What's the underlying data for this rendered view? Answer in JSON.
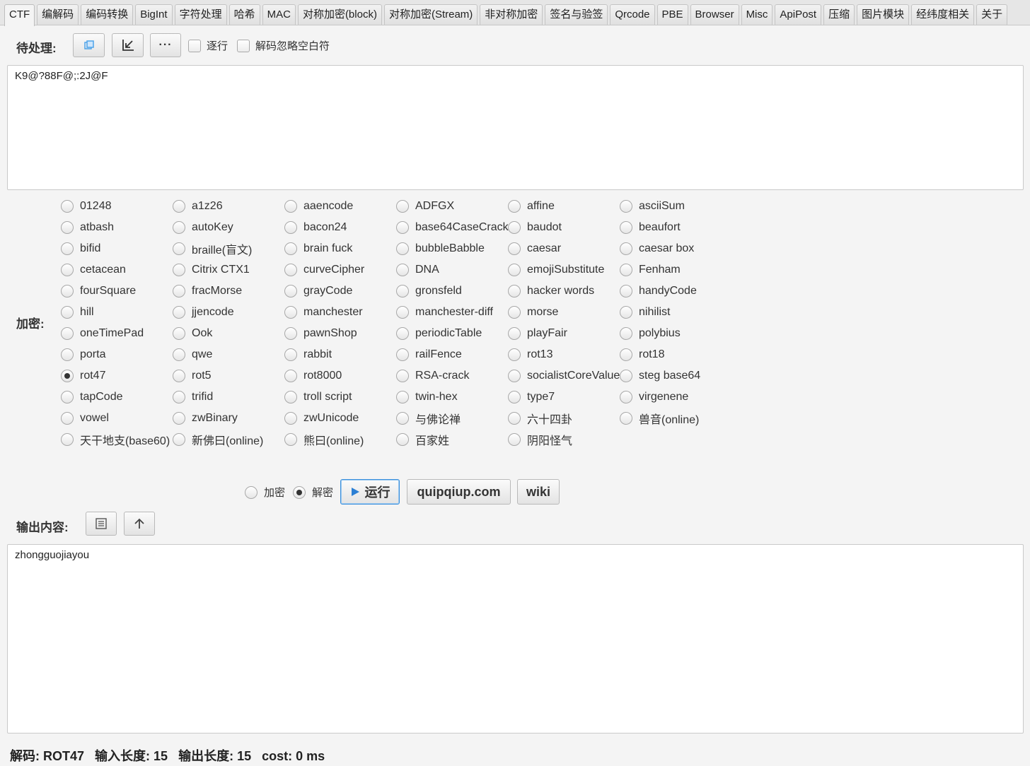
{
  "tabs": [
    "CTF",
    "编解码",
    "编码转换",
    "BigInt",
    "字符处理",
    "哈希",
    "MAC",
    "对称加密(block)",
    "对称加密(Stream)",
    "非对称加密",
    "签名与验签",
    "Qrcode",
    "PBE",
    "Browser",
    "Misc",
    "ApiPost",
    "压缩",
    "图片模块",
    "经纬度相关",
    "关于"
  ],
  "active_tab": "CTF",
  "input": {
    "label": "待处理:",
    "line_by_line_label": "逐行",
    "ignore_whitespace_label": "解码忽略空白符",
    "value": "K9@?88F@;:2J@F",
    "more_label": "···"
  },
  "algorithms": {
    "label": "加密:",
    "selected": "rot47",
    "options": [
      "01248",
      "a1z26",
      "aaencode",
      "ADFGX",
      "affine",
      "asciiSum",
      "atbash",
      "autoKey",
      "bacon24",
      "base64CaseCrack",
      "baudot",
      "beaufort",
      "bifid",
      "braille(盲文)",
      "brain fuck",
      "bubbleBabble",
      "caesar",
      "caesar box",
      "cetacean",
      "Citrix CTX1",
      "curveCipher",
      "DNA",
      "emojiSubstitute",
      "Fenham",
      "fourSquare",
      "fracMorse",
      "grayCode",
      "gronsfeld",
      "hacker words",
      "handyCode",
      "hill",
      "jjencode",
      "manchester",
      "manchester-diff",
      "morse",
      "nihilist",
      "oneTimePad",
      "Ook",
      "pawnShop",
      "periodicTable",
      "playFair",
      "polybius",
      "porta",
      "qwe",
      "rabbit",
      "railFence",
      "rot13",
      "rot18",
      "rot47",
      "rot5",
      "rot8000",
      "RSA-crack",
      "socialistCoreValue",
      "steg base64",
      "tapCode",
      "trifid",
      "troll script",
      "twin-hex",
      "type7",
      "virgenene",
      "vowel",
      "zwBinary",
      "zwUnicode",
      "与佛论禅",
      "六十四卦",
      "兽音(online)",
      "天干地支(base60)",
      "新佛曰(online)",
      "熊曰(online)",
      "百家姓",
      "阴阳怪气"
    ]
  },
  "actions": {
    "encrypt_label": "加密",
    "decrypt_label": "解密",
    "mode": "decrypt",
    "run_label": "运行",
    "quipqiup_label": "quipqiup.com",
    "wiki_label": "wiki"
  },
  "output": {
    "label": "输出内容:",
    "value": "zhongguojiayou"
  },
  "status": {
    "mode_text": "解码: ROT47",
    "input_len_text": "输入长度: 15",
    "output_len_text": "输出长度: 15",
    "cost_text": "cost: 0 ms"
  }
}
